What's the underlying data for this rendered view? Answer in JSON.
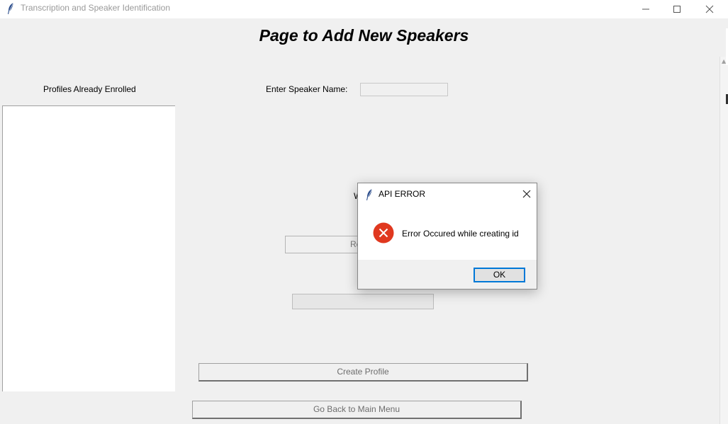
{
  "window": {
    "title": "Transcription and Speaker Identification",
    "icon": "feather-icon",
    "controls": [
      "minimize-icon",
      "maximize-icon",
      "close-icon"
    ]
  },
  "page": {
    "heading": "Page to Add New Speakers",
    "profiles_label": "Profiles Already Enrolled",
    "profiles": [],
    "speaker_name_label": "Enter Speaker Name:",
    "speaker_name_value": "",
    "partial_label": "W",
    "record_button_partial": "Re",
    "create_profile_label": "Create Profile",
    "back_button_label": "Go Back to Main Menu"
  },
  "dialog": {
    "title": "API ERROR",
    "message": "Error Occured while creating id",
    "ok_label": "OK",
    "icon": "error-icon",
    "error_color": "#e0381f"
  }
}
